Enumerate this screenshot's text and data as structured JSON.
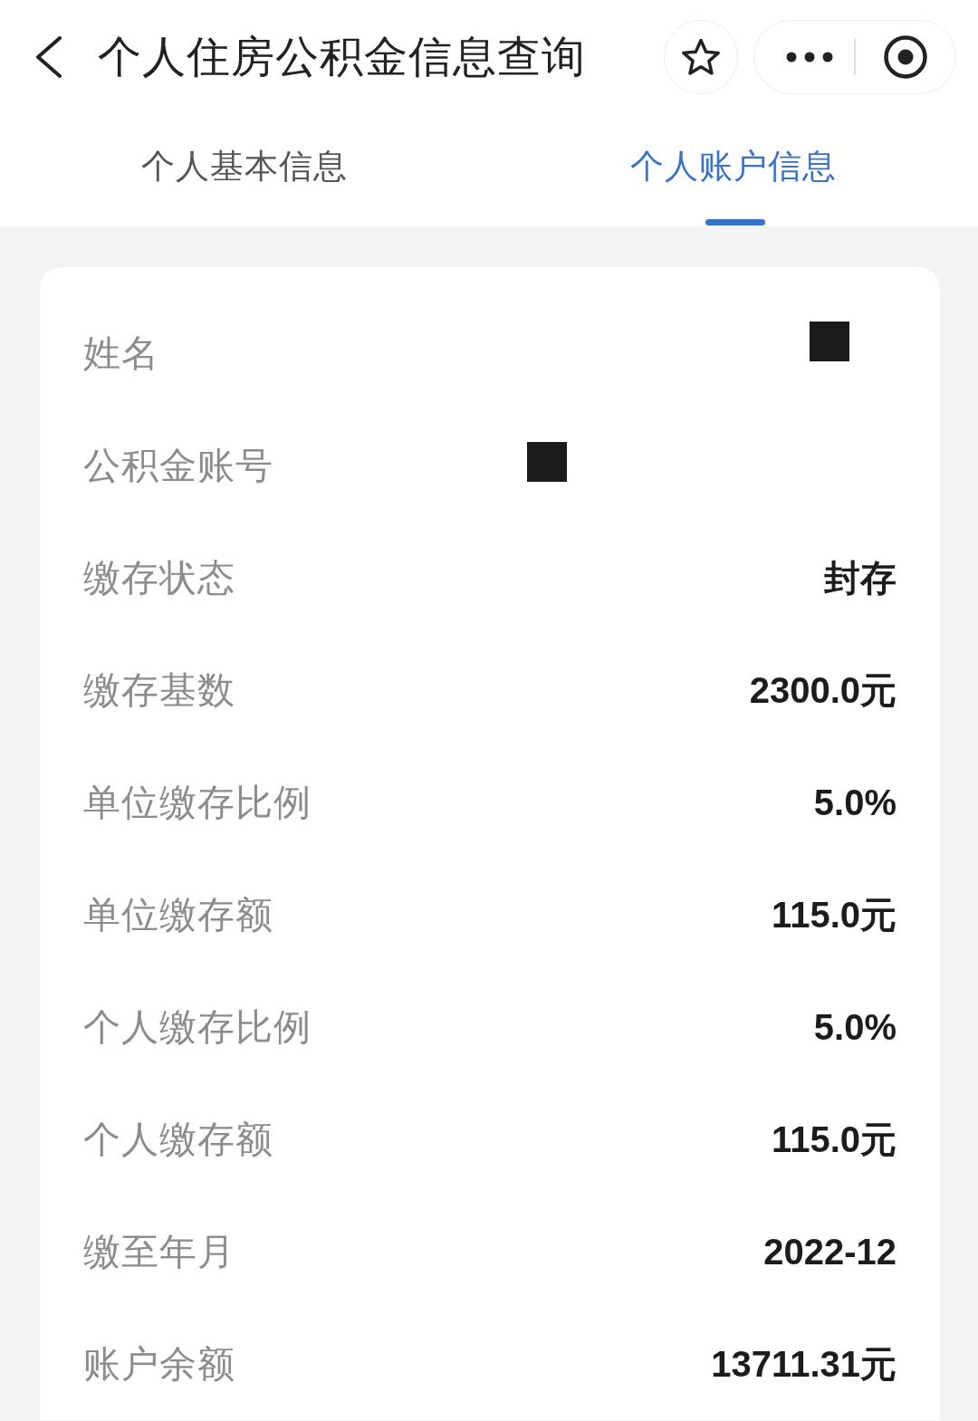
{
  "header": {
    "title": "个人住房公积金信息查询"
  },
  "tabs": [
    {
      "label": "个人基本信息",
      "selected": false
    },
    {
      "label": "个人账户信息",
      "selected": true
    }
  ],
  "fields": [
    {
      "label": "姓名",
      "kind": "redacted"
    },
    {
      "label": "公积金账号",
      "kind": "redacted"
    },
    {
      "label": "缴存状态",
      "kind": "text",
      "value": "封存"
    },
    {
      "label": "缴存基数",
      "kind": "text",
      "value": "2300.0元"
    },
    {
      "label": "单位缴存比例",
      "kind": "text",
      "value": "5.0%"
    },
    {
      "label": "单位缴存额",
      "kind": "text",
      "value": "115.0元"
    },
    {
      "label": "个人缴存比例",
      "kind": "text",
      "value": "5.0%"
    },
    {
      "label": "个人缴存额",
      "kind": "text",
      "value": "115.0元"
    },
    {
      "label": "缴至年月",
      "kind": "text",
      "value": "2022-12"
    },
    {
      "label": "账户余额",
      "kind": "text",
      "value": "13711.31元"
    }
  ]
}
